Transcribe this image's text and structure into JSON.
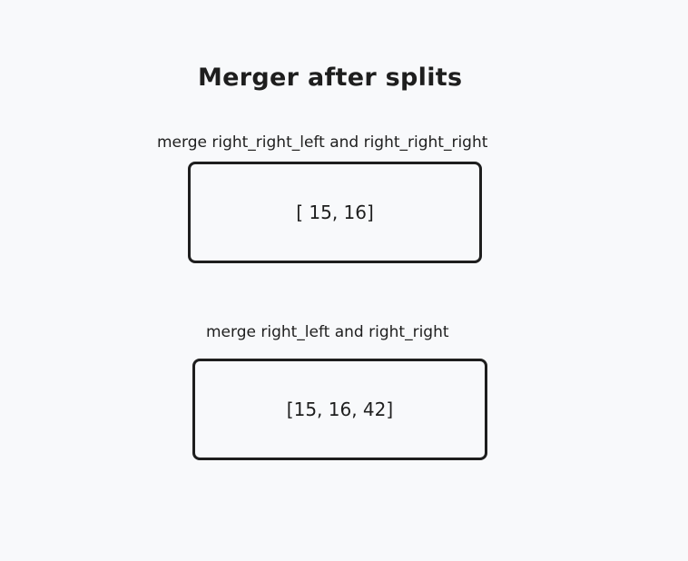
{
  "title": "Merger after splits",
  "steps": [
    {
      "label": "merge right_right_left and right_right_right",
      "result": "[ 15, 16]"
    },
    {
      "label": "merge right_left and right_right",
      "result": "[15, 16, 42]"
    }
  ]
}
